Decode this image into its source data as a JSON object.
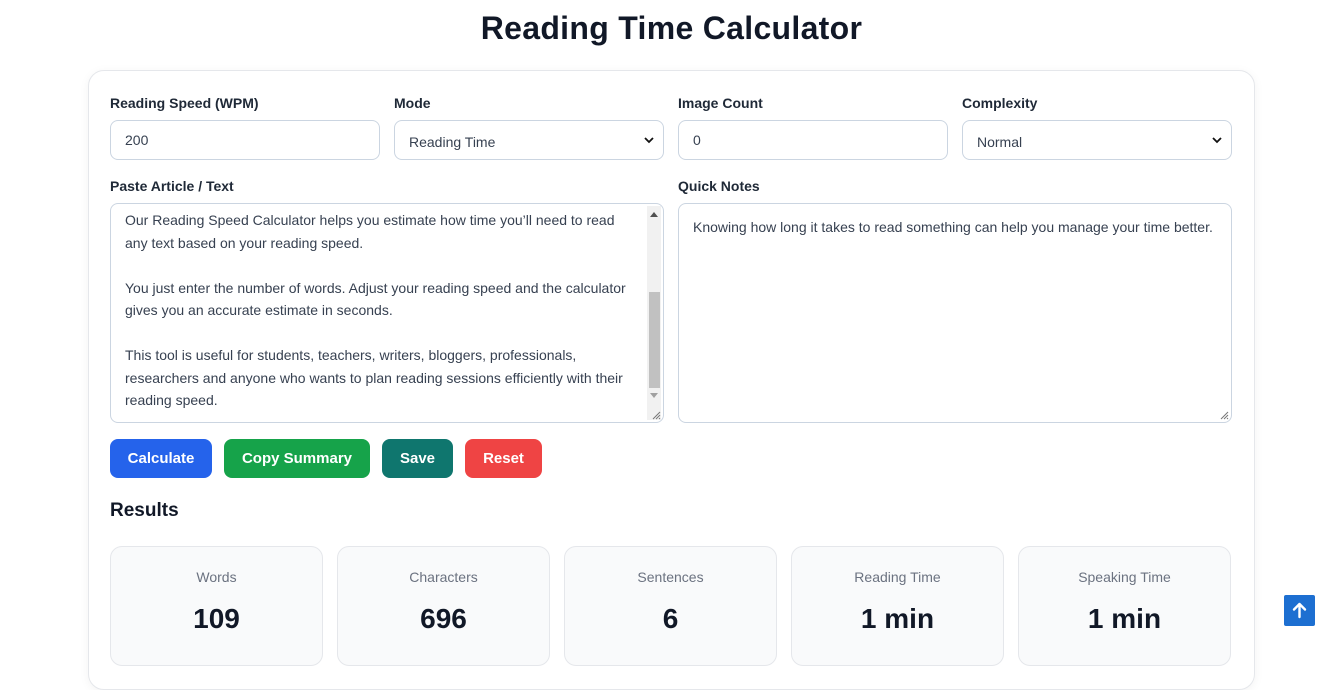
{
  "page_title": "Reading Time Calculator",
  "fields": {
    "speed": {
      "label": "Reading Speed (WPM)",
      "value": "200"
    },
    "mode": {
      "label": "Mode",
      "value": "Reading Time"
    },
    "image_count": {
      "label": "Image Count",
      "value": "0"
    },
    "complexity": {
      "label": "Complexity",
      "value": "Normal"
    },
    "article": {
      "label": "Paste Article / Text",
      "value": "Our Reading Speed Calculator helps you estimate how time you’ll need to read any text based on your reading speed.\n\nYou just enter the number of words. Adjust your reading speed and the calculator gives you an accurate estimate in seconds.\n\nThis tool is useful for students, teachers, writers, bloggers, professionals, researchers and anyone who wants to plan reading sessions efficiently with their reading speed."
    },
    "notes": {
      "label": "Quick Notes",
      "value": "Knowing how long it takes to read something can help you manage your time better."
    }
  },
  "buttons": {
    "calculate": "Calculate",
    "copy_summary": "Copy Summary",
    "save": "Save",
    "reset": "Reset"
  },
  "colors": {
    "calculate": "#2563eb",
    "copy_summary": "#16a34a",
    "save": "#0f766e",
    "reset": "#ef4444",
    "scroll_top": "#1d6fd1"
  },
  "results": {
    "title": "Results",
    "stats": [
      {
        "label": "Words",
        "value": "109"
      },
      {
        "label": "Characters",
        "value": "696"
      },
      {
        "label": "Sentences",
        "value": "6"
      },
      {
        "label": "Reading Time",
        "value": "1 min"
      },
      {
        "label": "Speaking Time",
        "value": "1 min"
      }
    ]
  },
  "icons": {
    "select_arrow": "chevron-down-icon",
    "scroll_top": "arrow-up-icon"
  }
}
